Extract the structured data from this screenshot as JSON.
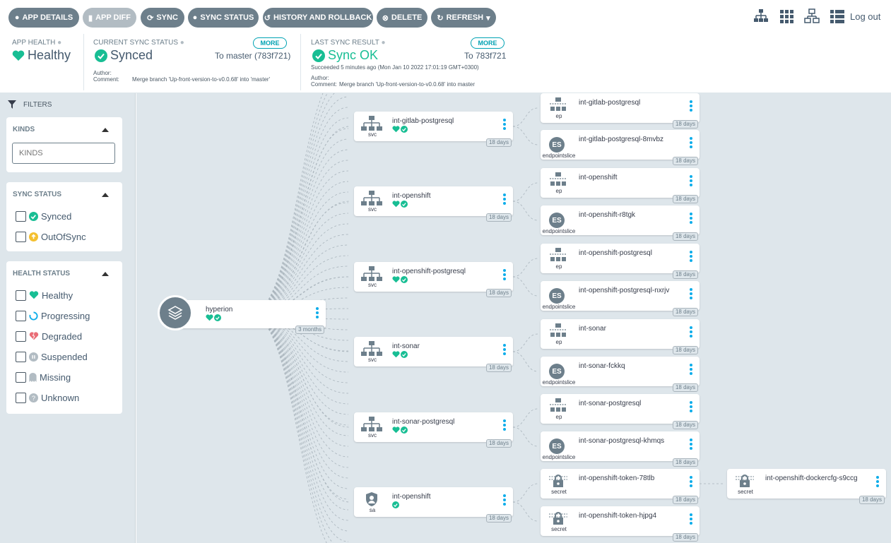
{
  "toolbar": {
    "buttons": [
      {
        "label": "APP DETAILS",
        "icon": "info-icon",
        "disabled": false
      },
      {
        "label": "APP DIFF",
        "icon": "file-icon",
        "disabled": true
      },
      {
        "label": "SYNC",
        "icon": "sync-icon",
        "disabled": false
      },
      {
        "label": "SYNC STATUS",
        "icon": "info-icon",
        "disabled": false
      },
      {
        "label": "HISTORY AND ROLLBACK",
        "icon": "history-icon",
        "disabled": false
      },
      {
        "label": "DELETE",
        "icon": "times-circle-icon",
        "disabled": false
      },
      {
        "label": "REFRESH",
        "icon": "redo-icon",
        "disabled": false
      }
    ],
    "logout": "Log out"
  },
  "status": {
    "app_health": {
      "title": "APP HEALTH",
      "value": "Healthy"
    },
    "current_sync": {
      "title": "CURRENT SYNC STATUS",
      "more": "MORE",
      "value": "Synced",
      "to": "To master (783f721)",
      "author_label": "Author:",
      "comment_label": "Comment:",
      "comment": "Merge branch 'Up-front-version-to-v0.0.68' into 'master'"
    },
    "last_sync": {
      "title": "LAST SYNC RESULT",
      "more": "MORE",
      "value": "Sync OK",
      "to": "To 783f721",
      "succeeded": "Succeeded 5 minutes ago (Mon Jan 10 2022 17:01:19 GMT+0300)",
      "author_label": "Author:",
      "comment_label": "Comment:",
      "comment": "Merge branch 'Up-front-version-to-v0.0.68' into master"
    }
  },
  "filters": {
    "title": "FILTERS",
    "kinds": {
      "title": "KINDS",
      "placeholder": "KINDS"
    },
    "sync_status": {
      "title": "SYNC STATUS",
      "items": [
        "Synced",
        "OutOfSync"
      ]
    },
    "health_status": {
      "title": "HEALTH STATUS",
      "items": [
        "Healthy",
        "Progressing",
        "Degraded",
        "Suspended",
        "Missing",
        "Unknown"
      ]
    }
  },
  "graph": {
    "root": {
      "name": "hyperion",
      "age": "3 months"
    },
    "mid_nodes": [
      {
        "name": "int-gitlab-postgresql",
        "kind": "svc",
        "age": "18 days"
      },
      {
        "name": "int-openshift",
        "kind": "svc",
        "age": "18 days"
      },
      {
        "name": "int-openshift-postgresql",
        "kind": "svc",
        "age": "18 days"
      },
      {
        "name": "int-sonar",
        "kind": "svc",
        "age": "18 days"
      },
      {
        "name": "int-sonar-postgresql",
        "kind": "svc",
        "age": "18 days"
      },
      {
        "name": "int-openshift",
        "kind": "sa",
        "age": "18 days"
      }
    ],
    "leaf_nodes": [
      {
        "name": "int-gitlab-postgresql",
        "kind": "ep",
        "age": "18 days"
      },
      {
        "name": "int-gitlab-postgresql-8mvbz",
        "kind": "endpointslice",
        "age": "18 days"
      },
      {
        "name": "int-openshift",
        "kind": "ep",
        "age": "18 days"
      },
      {
        "name": "int-openshift-r8tgk",
        "kind": "endpointslice",
        "age": "18 days"
      },
      {
        "name": "int-openshift-postgresql",
        "kind": "ep",
        "age": "18 days"
      },
      {
        "name": "int-openshift-postgresql-nxrjv",
        "kind": "endpointslice",
        "age": "18 days"
      },
      {
        "name": "int-sonar",
        "kind": "ep",
        "age": "18 days"
      },
      {
        "name": "int-sonar-fckkq",
        "kind": "endpointslice",
        "age": "18 days"
      },
      {
        "name": "int-sonar-postgresql",
        "kind": "ep",
        "age": "18 days"
      },
      {
        "name": "int-sonar-postgresql-khmqs",
        "kind": "endpointslice",
        "age": "18 days"
      },
      {
        "name": "int-openshift-token-78tlb",
        "kind": "secret",
        "age": "18 days"
      },
      {
        "name": "int-openshift-token-hjpg4",
        "kind": "secret",
        "age": "18 days"
      }
    ],
    "far_node": {
      "name": "int-openshift-dockercfg-s9ccg",
      "kind": "secret",
      "age": "18 days"
    },
    "es_label": "ES"
  },
  "colors": {
    "healthy": "#18be94",
    "synced": "#18be94",
    "outofsync": "#f4c030",
    "progressing": "#0dadea",
    "degraded": "#e96d76",
    "accent": "#00a2b3",
    "toolbar_btn": "#6d7f8b"
  }
}
